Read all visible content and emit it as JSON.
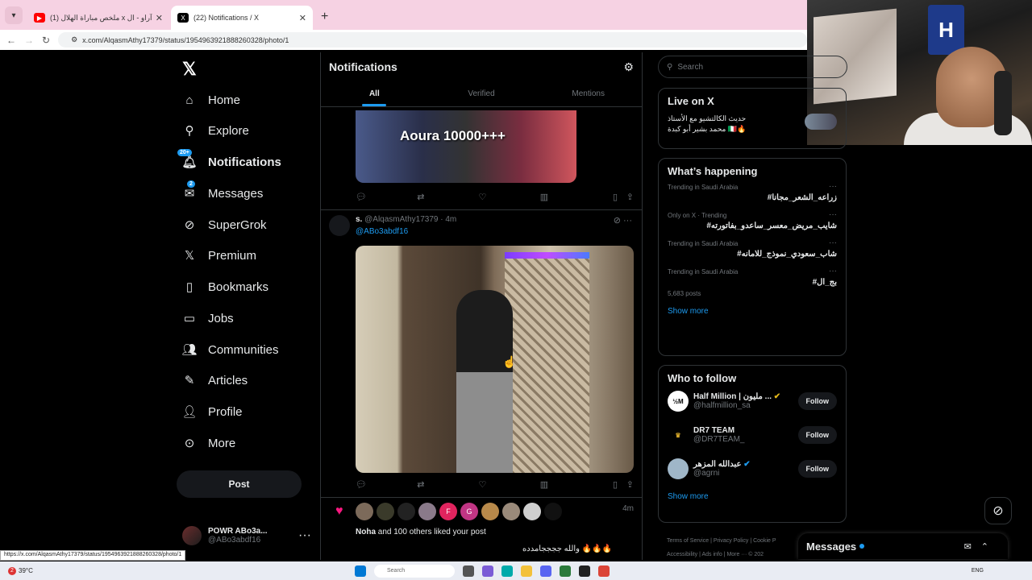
{
  "browser": {
    "tabs": [
      {
        "title": "(1) ملخص مباراة الهلال x آراو - ال",
        "favicon": "youtube-icon",
        "active": false
      },
      {
        "title": "(22) Notifications / X",
        "favicon": "x-icon",
        "active": true
      }
    ],
    "url": "x.com/AlqasmAthy17379/status/1954963921888260328/photo/1",
    "status_url": "https://x.com/AlqasmAthy17379/status/1954963921888260328/photo/1"
  },
  "nav": {
    "items": [
      {
        "label": "Home",
        "icon": "home-icon"
      },
      {
        "label": "Explore",
        "icon": "search-icon"
      },
      {
        "label": "Notifications",
        "icon": "bell-icon",
        "badge": "20+"
      },
      {
        "label": "Messages",
        "icon": "mail-icon",
        "badge": "2"
      },
      {
        "label": "SuperGrok",
        "icon": "grok-icon"
      },
      {
        "label": "Premium",
        "icon": "x-icon"
      },
      {
        "label": "Bookmarks",
        "icon": "bookmark-icon"
      },
      {
        "label": "Jobs",
        "icon": "briefcase-icon"
      },
      {
        "label": "Communities",
        "icon": "people-icon"
      },
      {
        "label": "Articles",
        "icon": "article-icon"
      },
      {
        "label": "Profile",
        "icon": "person-icon"
      },
      {
        "label": "More",
        "icon": "more-circle-icon"
      }
    ],
    "post_label": "Post",
    "account": {
      "name": "POWR ABo3a...",
      "handle": "@ABo3abdf16"
    }
  },
  "main": {
    "title": "Notifications",
    "tabs": [
      "All",
      "Verified",
      "Mentions"
    ],
    "media1_caption": "Aoura 10000+++",
    "tweet2": {
      "name": "s.",
      "handle": "@AlqasmAthy17379",
      "time": "4m",
      "reply_to": "@ABo3abdf16"
    },
    "likes": {
      "time": "4m",
      "avatars": [
        "",
        "",
        "",
        "",
        "F",
        "G",
        "",
        "",
        "",
        ""
      ],
      "text": "and 100 others liked your post",
      "liker": "Noha",
      "arabic": "والله ججججامدده 🔥🔥🔥"
    }
  },
  "right": {
    "search_placeholder": "Search",
    "live": {
      "title": "Live on X",
      "text1": "حديث الكالتشيو مع الأستاذ",
      "text2": "محمد بشير أبو كبدة 🇮🇹🔥"
    },
    "happening": {
      "title": "What’s happening",
      "trends": [
        {
          "meta": "Trending in Saudi Arabia",
          "name": "#زراعه_الشعر_مجانا",
          "count": ""
        },
        {
          "meta": "Only on X · Trending",
          "name": "#شايب_مريض_معسر_ساعدو_بفاتورته",
          "count": ""
        },
        {
          "meta": "Trending in Saudi Arabia",
          "name": "#شاب_سعودي_نموذج_للامانه",
          "count": ""
        },
        {
          "meta": "Trending in Saudi Arabia",
          "name": "#بج_ال",
          "count": "5,683 posts"
        }
      ],
      "show_more": "Show more"
    },
    "who": {
      "title": "Who to follow",
      "people": [
        {
          "name": "Half Million | مليون ...",
          "handle": "@halfmillion_sa",
          "avatar_text": "½M",
          "avatar_bg": "#ffffff",
          "avatar_fg": "#000000"
        },
        {
          "name": "DR7 TEAM",
          "handle": "@DR7TEAM_",
          "avatar_text": "♛",
          "avatar_bg": "#000000",
          "avatar_fg": "#d4a62a"
        },
        {
          "name": "عبدالله المزهر",
          "handle": "@agrni",
          "avatar_text": "",
          "avatar_bg": "#9fb6c8",
          "avatar_fg": "#000000"
        }
      ],
      "follow_label": "Follow",
      "show_more": "Show more"
    },
    "footer": {
      "line1": "Terms of Service | Privacy Policy | Cookie P",
      "line2": "Accessibility | Ads info | More ··· © 202"
    }
  },
  "messages_bar": {
    "label": "Messages"
  },
  "taskbar": {
    "temp": "39°C",
    "alert": "2",
    "search": "Search",
    "lang": "ENG"
  },
  "colors": {
    "accent": "#1d9bf0",
    "like": "#f91880",
    "tabbar": "#f6d2e3"
  }
}
